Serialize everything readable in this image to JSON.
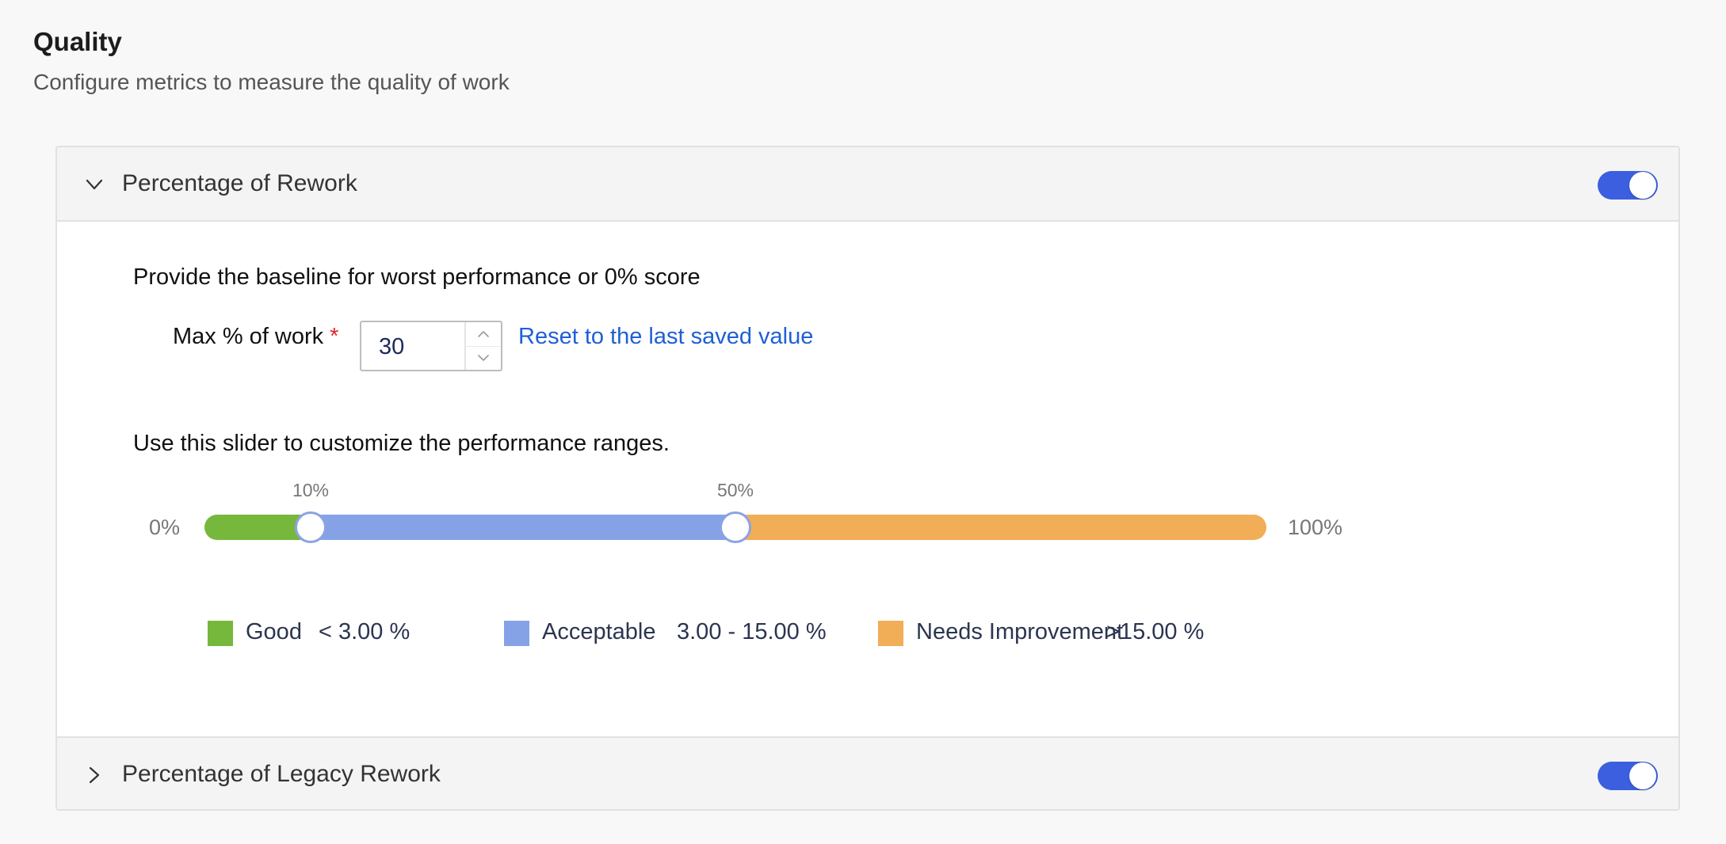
{
  "page": {
    "title": "Quality",
    "subtitle": "Configure metrics to measure the quality of work"
  },
  "sections": [
    {
      "title": "Percentage of Rework",
      "expanded": true,
      "enabled": true
    },
    {
      "title": "Percentage of Legacy Rework",
      "expanded": false,
      "enabled": true
    }
  ],
  "rework": {
    "baseline_text": "Provide the baseline for worst performance or 0% score",
    "max_label": "Max % of work",
    "required_marker": "*",
    "max_value": "30",
    "reset_label": "Reset to the last saved value",
    "slider_text": "Use this slider to customize the performance ranges.",
    "slider": {
      "min_label": "0%",
      "max_label": "100%",
      "handle1_label": "10%",
      "handle2_label": "50%",
      "handle1_value": 10,
      "handle2_value": 50
    },
    "legend": [
      {
        "name": "Good",
        "range": "< 3.00 %",
        "color": "#75b83c"
      },
      {
        "name": "Acceptable",
        "range": "3.00 - 15.00 %",
        "color": "#86a2e6"
      },
      {
        "name": "Needs Improvement",
        "range": ">15.00 %",
        "color": "#f2ad57"
      }
    ]
  },
  "colors": {
    "toggle_on": "#3b5fde",
    "link": "#1f5fd6",
    "required": "#e0262b",
    "good": "#75b83c",
    "acceptable": "#86a2e6",
    "needs_improvement": "#f2ad57"
  }
}
